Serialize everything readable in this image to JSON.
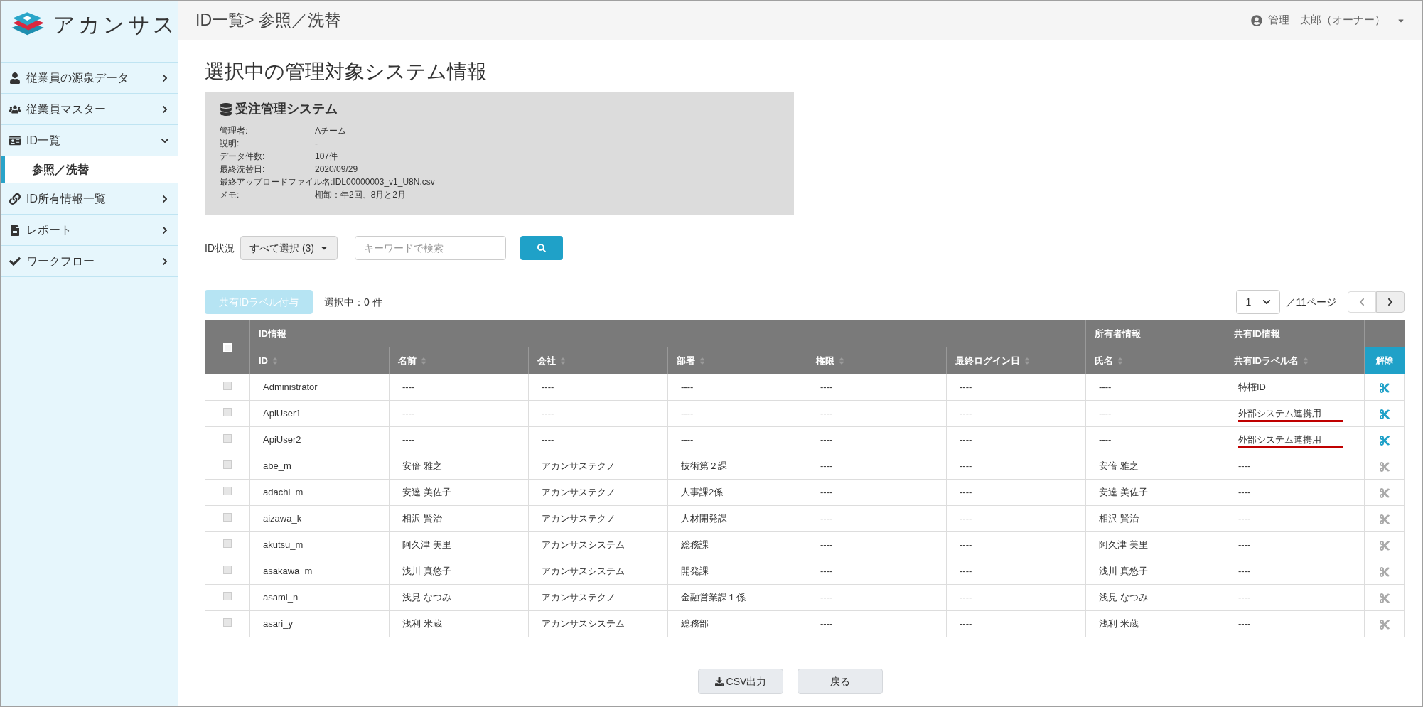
{
  "logo": {
    "text": "アカンサス"
  },
  "breadcrumb": "ID一覧> 参照／洗替",
  "user": {
    "name": "管理　太郎（オーナー）"
  },
  "sidebar": {
    "items": [
      {
        "label": "従業員の源泉データ",
        "expanded": false
      },
      {
        "label": "従業員マスター",
        "expanded": false
      },
      {
        "label": "ID一覧",
        "expanded": true,
        "children": [
          {
            "label": "参照／洗替",
            "selected": true
          }
        ]
      },
      {
        "label": "ID所有情報一覧",
        "expanded": false
      },
      {
        "label": "レポート",
        "expanded": false
      },
      {
        "label": "ワークフロー",
        "expanded": false
      }
    ]
  },
  "page_title": "選択中の管理対象システム情報",
  "system": {
    "name": "受注管理システム",
    "fields": [
      {
        "label": "管理者:",
        "value": "Aチーム"
      },
      {
        "label": "説明:",
        "value": "-"
      },
      {
        "label": "データ件数:",
        "value": "107件"
      },
      {
        "label": "最終洗替日:",
        "value": "2020/09/29"
      },
      {
        "label": "最終アップロードファイル名:",
        "value": "IDL00000003_v1_U8N.csv"
      },
      {
        "label": "メモ:",
        "value": "棚卸：年2回、8月と2月"
      }
    ]
  },
  "filter": {
    "label": "ID状況",
    "dropdown": "すべて選択 (3)",
    "search": {
      "placeholder": "キーワードで検索"
    }
  },
  "toolbar": {
    "assign_button": {
      "label": "共有IDラベル付与",
      "disabled": true
    },
    "selection": "選択中：0 件"
  },
  "pagination": {
    "page": "1",
    "total": "／11ページ",
    "prev_disabled": true,
    "next_disabled": false
  },
  "table": {
    "select_all": {
      "checked": false
    },
    "groups": [
      "ID情報",
      "所有者情報",
      "共有ID情報"
    ],
    "columns": [
      "ID",
      "名前",
      "会社",
      "部署",
      "権限",
      "最終ログイン日",
      "氏名",
      "共有IDラベル名"
    ],
    "action_column": "解除",
    "rows": [
      {
        "checked": false,
        "cells": [
          "Administrator",
          "----",
          "----",
          "----",
          "----",
          "----",
          "----",
          "特権ID"
        ],
        "underlined": false,
        "removable": true
      },
      {
        "checked": false,
        "cells": [
          "ApiUser1",
          "----",
          "----",
          "----",
          "----",
          "----",
          "----",
          "外部システム連携用"
        ],
        "underlined": true,
        "removable": true
      },
      {
        "checked": false,
        "cells": [
          "ApiUser2",
          "----",
          "----",
          "----",
          "----",
          "----",
          "----",
          "外部システム連携用"
        ],
        "underlined": true,
        "removable": true
      },
      {
        "checked": false,
        "cells": [
          "abe_m",
          "安倍 雅之",
          "アカンサステクノ",
          "技術第２課",
          "----",
          "----",
          "安倍 雅之",
          "----"
        ],
        "underlined": false,
        "removable": false
      },
      {
        "checked": false,
        "cells": [
          "adachi_m",
          "安達 美佐子",
          "アカンサステクノ",
          "人事課2係",
          "----",
          "----",
          "安達 美佐子",
          "----"
        ],
        "underlined": false,
        "removable": false
      },
      {
        "checked": false,
        "cells": [
          "aizawa_k",
          "相沢 賢治",
          "アカンサステクノ",
          "人材開発課",
          "----",
          "----",
          "相沢 賢治",
          "----"
        ],
        "underlined": false,
        "removable": false
      },
      {
        "checked": false,
        "cells": [
          "akutsu_m",
          "阿久津 美里",
          "アカンサスシステム",
          "総務課",
          "----",
          "----",
          "阿久津 美里",
          "----"
        ],
        "underlined": false,
        "removable": false
      },
      {
        "checked": false,
        "cells": [
          "asakawa_m",
          "浅川 真悠子",
          "アカンサスシステム",
          "開発課",
          "----",
          "----",
          "浅川 真悠子",
          "----"
        ],
        "underlined": false,
        "removable": false
      },
      {
        "checked": false,
        "cells": [
          "asami_n",
          "浅見 なつみ",
          "アカンサステクノ",
          "金融営業課１係",
          "----",
          "----",
          "浅見 なつみ",
          "----"
        ],
        "underlined": false,
        "removable": false
      },
      {
        "checked": false,
        "cells": [
          "asari_y",
          "浅利 米蔵",
          "アカンサスシステム",
          "総務部",
          "----",
          "----",
          "浅利 米蔵",
          "----"
        ],
        "underlined": false,
        "removable": false
      }
    ]
  },
  "footer": {
    "csv_button": "CSV出力",
    "back_button": "戻る"
  }
}
